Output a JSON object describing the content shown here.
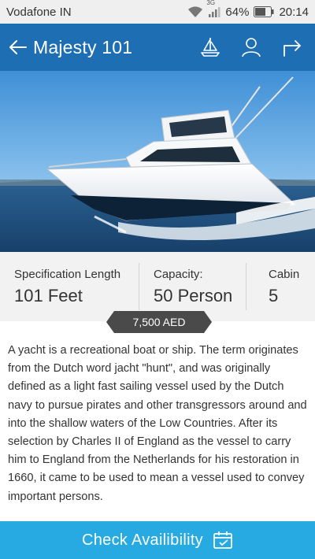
{
  "status_bar": {
    "carrier": "Vodafone IN",
    "network": "3G",
    "battery": "64%",
    "time": "20:14"
  },
  "header": {
    "title": "Majesty 101",
    "icons": [
      "back-arrow-icon",
      "sailboat-icon",
      "user-icon",
      "share-arrow-icon"
    ]
  },
  "specs": [
    {
      "label": "Specification Length",
      "value": "101 Feet"
    },
    {
      "label": "Capacity:",
      "value": "50 Person"
    },
    {
      "label": "Cabin",
      "value": "5"
    }
  ],
  "price": "7,500 AED",
  "description": "A yacht is a recreational boat or ship. The term originates from the Dutch word jacht \"hunt\", and was originally defined as a light fast sailing vessel used by the Dutch navy to pursue pirates and other transgressors around and into the shallow waters of the Low Countries. After its selection by Charles II of England as the vessel to carry him to England from the Netherlands for his restoration in 1660, it came to be used to mean a vessel used to convey important persons.",
  "cta": {
    "label": "Check Availibility",
    "icon": "calendar-icon"
  },
  "colors": {
    "header_blue": "#1e6eb4",
    "cta_blue": "#27aae1",
    "price_tag": "#4a4a4a"
  }
}
